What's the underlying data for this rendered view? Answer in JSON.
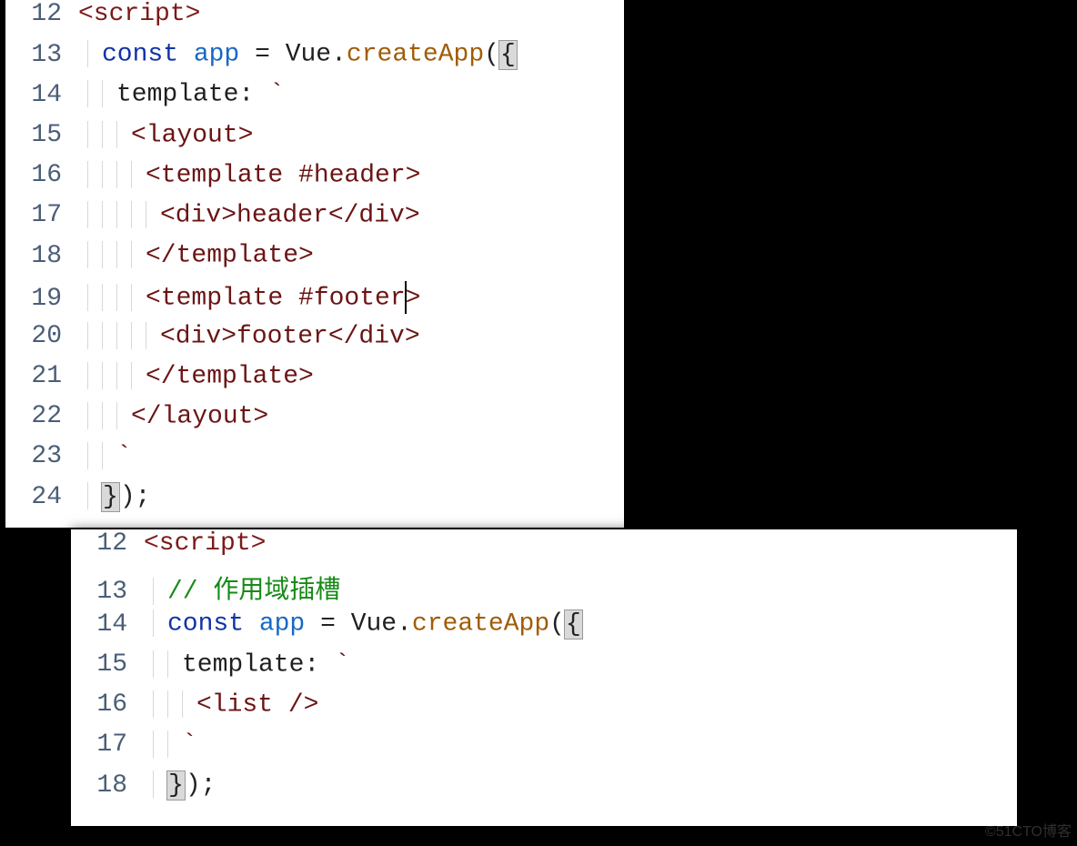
{
  "watermark": "©51CTO博客",
  "pane1": {
    "lines": [
      {
        "num": "12",
        "indent": 0,
        "tokens": [
          {
            "t": "tag",
            "v": "<script>"
          }
        ]
      },
      {
        "num": "13",
        "indent": 1,
        "tokens": [
          {
            "t": "kw",
            "v": "const"
          },
          {
            "t": "txt",
            "v": " "
          },
          {
            "t": "var",
            "v": "app"
          },
          {
            "t": "txt",
            "v": " "
          },
          {
            "t": "punct",
            "v": "="
          },
          {
            "t": "txt",
            "v": " "
          },
          {
            "t": "ident",
            "v": "Vue"
          },
          {
            "t": "punct",
            "v": "."
          },
          {
            "t": "fn",
            "v": "createApp"
          },
          {
            "t": "punct",
            "v": "("
          },
          {
            "t": "brace-hl",
            "v": "{"
          }
        ]
      },
      {
        "num": "14",
        "indent": 2,
        "tokens": [
          {
            "t": "ident",
            "v": "template"
          },
          {
            "t": "punct",
            "v": ":"
          },
          {
            "t": "txt",
            "v": " "
          },
          {
            "t": "str",
            "v": "`"
          }
        ]
      },
      {
        "num": "15",
        "indent": 3,
        "tokens": [
          {
            "t": "str",
            "v": "<layout>"
          }
        ]
      },
      {
        "num": "16",
        "indent": 4,
        "tokens": [
          {
            "t": "str",
            "v": "<template #header>"
          }
        ]
      },
      {
        "num": "17",
        "indent": 5,
        "tokens": [
          {
            "t": "str",
            "v": "<div>header</div>"
          }
        ]
      },
      {
        "num": "18",
        "indent": 4,
        "tokens": [
          {
            "t": "str",
            "v": "</template>"
          }
        ]
      },
      {
        "num": "19",
        "indent": 4,
        "cursorAfter": 16,
        "tokens": [
          {
            "t": "str",
            "v": "<template #footer>"
          }
        ]
      },
      {
        "num": "20",
        "indent": 5,
        "tokens": [
          {
            "t": "str",
            "v": "<div>footer</div>"
          }
        ]
      },
      {
        "num": "21",
        "indent": 4,
        "tokens": [
          {
            "t": "str",
            "v": "</template>"
          }
        ]
      },
      {
        "num": "22",
        "indent": 3,
        "tokens": [
          {
            "t": "str",
            "v": "</layout>"
          }
        ]
      },
      {
        "num": "23",
        "indent": 2,
        "tokens": [
          {
            "t": "str",
            "v": "`"
          }
        ]
      },
      {
        "num": "24",
        "indent": 1,
        "tokens": [
          {
            "t": "brace-hl",
            "v": "}"
          },
          {
            "t": "punct",
            "v": ")"
          },
          {
            "t": "punct",
            "v": ";"
          }
        ]
      }
    ]
  },
  "pane2": {
    "lines": [
      {
        "num": "12",
        "indent": 0,
        "tokens": [
          {
            "t": "tag",
            "v": "<script>"
          }
        ]
      },
      {
        "num": "13",
        "indent": 1,
        "tokens": [
          {
            "t": "comment",
            "v": "// 作用域插槽"
          }
        ]
      },
      {
        "num": "14",
        "indent": 1,
        "tokens": [
          {
            "t": "kw",
            "v": "const"
          },
          {
            "t": "txt",
            "v": " "
          },
          {
            "t": "var",
            "v": "app"
          },
          {
            "t": "txt",
            "v": " "
          },
          {
            "t": "punct",
            "v": "="
          },
          {
            "t": "txt",
            "v": " "
          },
          {
            "t": "ident",
            "v": "Vue"
          },
          {
            "t": "punct",
            "v": "."
          },
          {
            "t": "fn",
            "v": "createApp"
          },
          {
            "t": "punct",
            "v": "("
          },
          {
            "t": "brace-hl",
            "v": "{"
          }
        ]
      },
      {
        "num": "15",
        "indent": 2,
        "tokens": [
          {
            "t": "ident",
            "v": "template"
          },
          {
            "t": "punct",
            "v": ":"
          },
          {
            "t": "txt",
            "v": " "
          },
          {
            "t": "str",
            "v": "`"
          }
        ]
      },
      {
        "num": "16",
        "indent": 3,
        "tokens": [
          {
            "t": "str",
            "v": "<list />"
          }
        ]
      },
      {
        "num": "17",
        "indent": 2,
        "tokens": [
          {
            "t": "str",
            "v": "`"
          }
        ]
      },
      {
        "num": "18",
        "indent": 1,
        "tokens": [
          {
            "t": "brace-hl",
            "v": "}"
          },
          {
            "t": "punct",
            "v": ")"
          },
          {
            "t": "punct",
            "v": ";"
          }
        ]
      }
    ]
  }
}
